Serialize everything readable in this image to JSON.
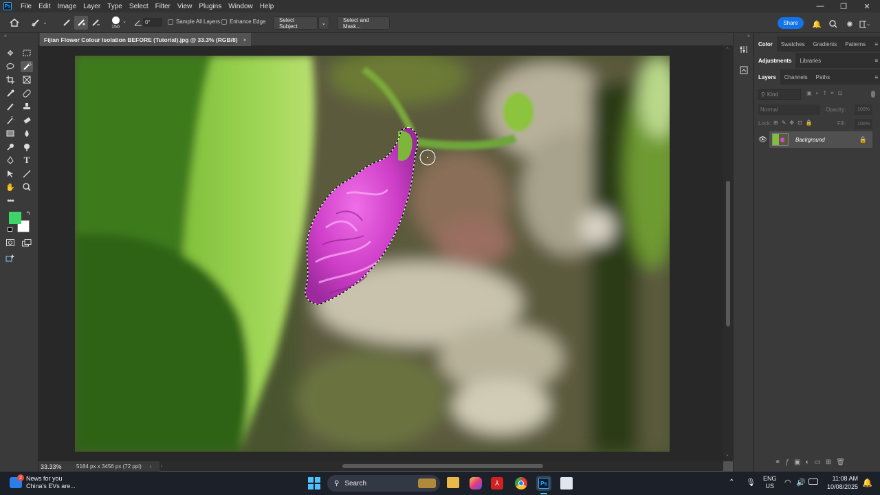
{
  "app": {
    "logo": "Ps"
  },
  "menu": [
    "File",
    "Edit",
    "Image",
    "Layer",
    "Type",
    "Select",
    "Filter",
    "View",
    "Plugins",
    "Window",
    "Help"
  ],
  "window_controls": {
    "minimize": "—",
    "restore": "❐",
    "close": "✕"
  },
  "options_bar": {
    "brush_size": "150",
    "angle": "0°",
    "sample_all_layers": "Sample All Layers",
    "enhance_edge": "Enhance Edge",
    "select_subject": "Select Subject",
    "select_and_mask": "Select and Mask...",
    "share": "Share"
  },
  "document": {
    "tab_title": "Fijian Flower Colour Isolation BEFORE (Tutorial).jpg @ 33.3% (RGB/8)",
    "close": "×",
    "zoom": "33.33%",
    "dimensions": "5184 px x 3456 px (72 ppi)"
  },
  "colors": {
    "foreground": "#3fd36a",
    "background": "#ffffff",
    "accent": "#1473e6"
  },
  "panels": {
    "top_tabs": [
      "Color",
      "Swatches",
      "Gradients",
      "Patterns"
    ],
    "mid_tabs": [
      "Adjustments",
      "Libraries"
    ],
    "layer_tabs": [
      "Layers",
      "Channels",
      "Paths"
    ],
    "kind_placeholder": "Kind",
    "blend_mode": "Normal",
    "opacity_label": "Opacity:",
    "opacity_value": "100%",
    "lock_label": "Lock:",
    "fill_label": "Fill:",
    "fill_value": "100%",
    "layer_name": "Background"
  },
  "taskbar": {
    "news_title": "News for you",
    "news_sub": "China's EVs are...",
    "news_badge": "2",
    "search": "Search",
    "lang": "ENG",
    "region": "US",
    "time": "11:08 AM",
    "date": "10/08/2025"
  }
}
